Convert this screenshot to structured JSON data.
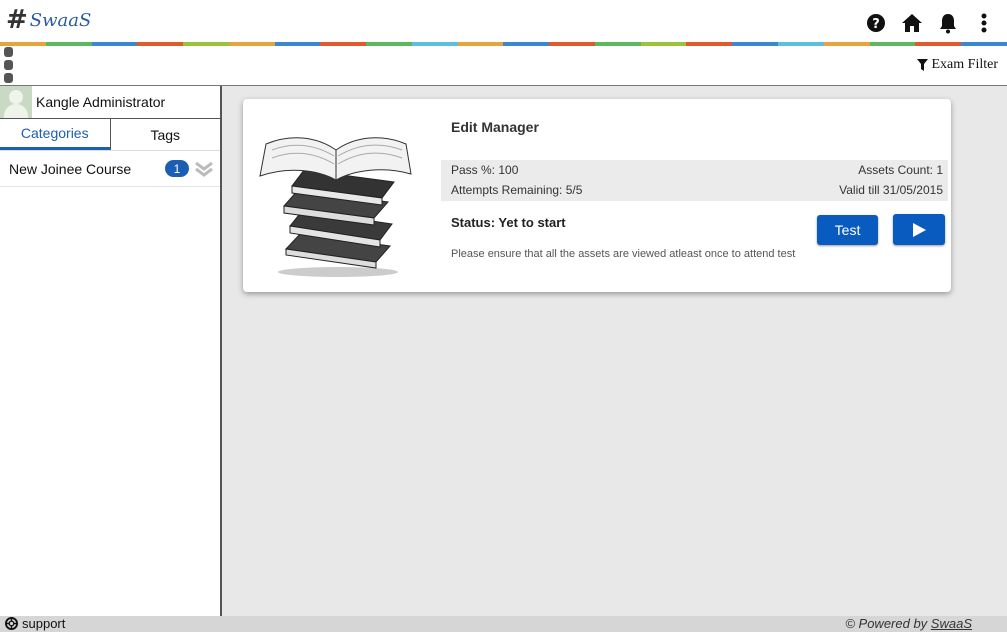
{
  "header": {
    "logo_mark": "#",
    "logo_text": "SwaaS",
    "icons": [
      "help-icon",
      "home-icon",
      "bell-icon",
      "more-vertical-icon"
    ],
    "stripe_colors": [
      "#e8a33c",
      "#5cb85c",
      "#3a87d4",
      "#e05a2b",
      "#9ac43c",
      "#e8a33c",
      "#3a87d4",
      "#e05a2b",
      "#5cb85c",
      "#5bc0de",
      "#e8a33c",
      "#3a87d4",
      "#e05a2b",
      "#5cb85c",
      "#9ac43c",
      "#e05a2b",
      "#3a87d4",
      "#5bc0de",
      "#e8a33c",
      "#5cb85c",
      "#e05a2b",
      "#3a87d4"
    ]
  },
  "subbar": {
    "exam_filter_label": "Exam Filter"
  },
  "sidebar": {
    "user_name": "Kangle Administrator",
    "tabs": [
      {
        "label": "Categories",
        "active": true
      },
      {
        "label": "Tags",
        "active": false
      }
    ],
    "categories": [
      {
        "label": "New Joinee Course",
        "count": "1"
      }
    ]
  },
  "card": {
    "title": "Edit Manager",
    "pass_percent": "Pass %: 100",
    "assets_count": "Assets Count: 1",
    "attempts_remaining": "Attempts Remaining: 5/5",
    "valid_till": "Valid till 31/05/2015",
    "status": "Status: Yet to start",
    "note": "Please ensure that all the assets are viewed atleast once to attend test",
    "test_button": "Test"
  },
  "footer": {
    "support_label": "support",
    "powered_prefix": "© Powered by ",
    "powered_link": "SwaaS"
  },
  "colors": {
    "accent": "#1a5fb4",
    "button": "#0a5bbf",
    "main_bg": "#e8e8e8",
    "footer_bg": "#d6d6d6"
  }
}
